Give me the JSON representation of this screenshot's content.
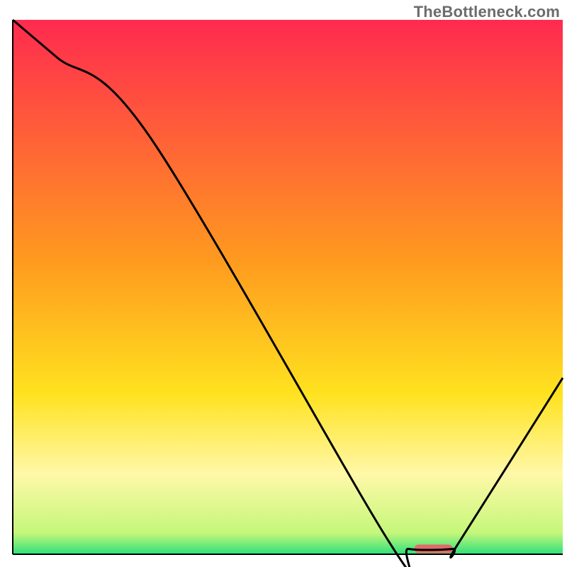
{
  "watermark": "TheBottleneck.com",
  "chart_data": {
    "type": "line",
    "title": "",
    "xlabel": "",
    "ylabel": "",
    "xlim": [
      0,
      100
    ],
    "ylim": [
      0,
      100
    ],
    "grid": false,
    "legend": false,
    "background_gradient": {
      "direction": "vertical",
      "stops": [
        {
          "y": 0,
          "color": "#ff2a4f"
        },
        {
          "y": 45,
          "color": "#ff9a1f"
        },
        {
          "y": 70,
          "color": "#ffe21f"
        },
        {
          "y": 85,
          "color": "#fff8a8"
        },
        {
          "y": 96,
          "color": "#c5f77a"
        },
        {
          "y": 100,
          "color": "#2fe07a"
        }
      ]
    },
    "series": [
      {
        "name": "bottleneck-curve",
        "color": "#000000",
        "x": [
          0,
          8,
          25,
          68,
          72,
          80,
          81,
          100
        ],
        "values": [
          100,
          93,
          78,
          3,
          1,
          1,
          2,
          33
        ]
      }
    ],
    "markers": [
      {
        "name": "optimal-region",
        "shape": "rounded-rect",
        "color": "#e46a6a",
        "x_start": 73,
        "x_end": 80,
        "y": 1,
        "height": 1.6
      }
    ]
  }
}
